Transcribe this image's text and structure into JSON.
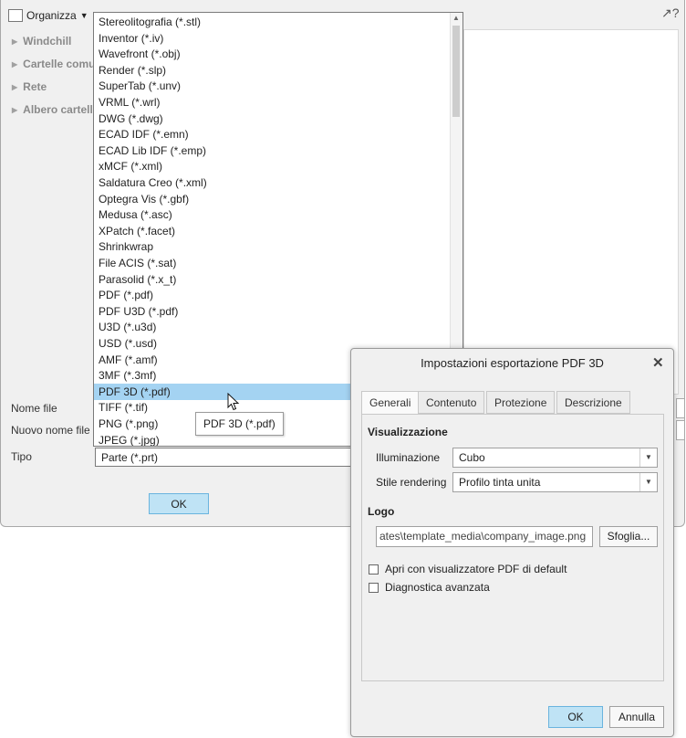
{
  "save_dialog": {
    "toolbar": {
      "organize_label": "Organizza"
    },
    "nav": [
      "Windchill",
      "Cartelle comuni",
      "Rete",
      "Albero cartelle"
    ],
    "labels": {
      "file_name": "Nome file",
      "new_file_name": "Nuovo nome file",
      "type": "Tipo"
    },
    "type_value": "Parte (*.prt)",
    "ok_label": "OK"
  },
  "type_dropdown": {
    "items": [
      "Stereolitografia (*.stl)",
      "Inventor (*.iv)",
      "Wavefront (*.obj)",
      "Render (*.slp)",
      "SuperTab (*.unv)",
      "VRML (*.wrl)",
      "DWG (*.dwg)",
      "ECAD IDF (*.emn)",
      "ECAD Lib IDF (*.emp)",
      "xMCF  (*.xml)",
      "Saldatura Creo (*.xml)",
      "Optegra Vis (*.gbf)",
      "Medusa (*.asc)",
      "XPatch (*.facet)",
      "Shrinkwrap",
      "File ACIS (*.sat)",
      "Parasolid (*.x_t)",
      "PDF (*.pdf)",
      "PDF U3D (*.pdf)",
      "U3D (*.u3d)",
      "USD (*.usd)",
      "AMF (*.amf)",
      "3MF (*.3mf)",
      "PDF 3D (*.pdf)",
      "TIFF (*.tif)",
      "PNG (*.png)",
      "JPEG (*.jpg)"
    ],
    "selected_index": 23,
    "tooltip": "PDF 3D (*.pdf)"
  },
  "pdf_dialog": {
    "title": "Impostazioni esportazione PDF 3D",
    "tabs": [
      "Generali",
      "Contenuto",
      "Protezione",
      "Descrizione"
    ],
    "active_tab": 0,
    "visualization": {
      "title": "Visualizzazione",
      "lighting_label": "Illuminazione",
      "lighting_value": "Cubo",
      "render_style_label": "Stile rendering",
      "render_style_value": "Profilo tinta unita"
    },
    "logo": {
      "title": "Logo",
      "path": "ates\\template_media\\company_image.png",
      "browse_label": "Sfoglia..."
    },
    "options": [
      {
        "label": "Apri con visualizzatore PDF di default",
        "checked": false
      },
      {
        "label": "Diagnostica avanzata",
        "checked": false
      }
    ],
    "ok_label": "OK",
    "cancel_label": "Annulla"
  },
  "colors": {
    "selection": "#a4d3f2",
    "primary_button": "#bfe3f5",
    "primary_button_border": "#6ab4de",
    "dialog_bg": "#f0f0f0"
  }
}
